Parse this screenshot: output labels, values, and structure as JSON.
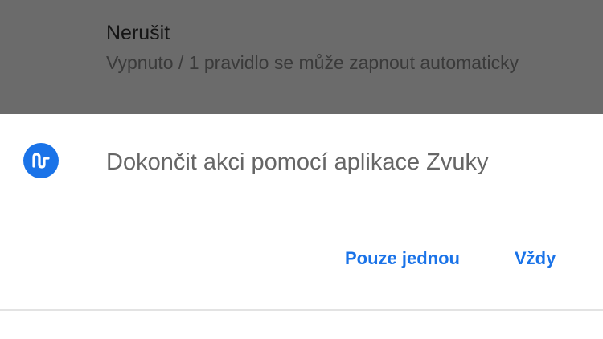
{
  "background_setting": {
    "title": "Nerušit",
    "subtitle": "Vypnuto / 1 pravidlo se může zapnout automaticky"
  },
  "chooser": {
    "app_icon": "music-note-icon",
    "title": "Dokončit akci pomocí aplikace Zvuky",
    "buttons": {
      "just_once": "Pouze jednou",
      "always": "Vždy"
    }
  },
  "colors": {
    "accent": "#1a73e8",
    "scrim_background": "#6b6b6b",
    "sheet_background": "#ffffff",
    "title_text": "#666666"
  }
}
